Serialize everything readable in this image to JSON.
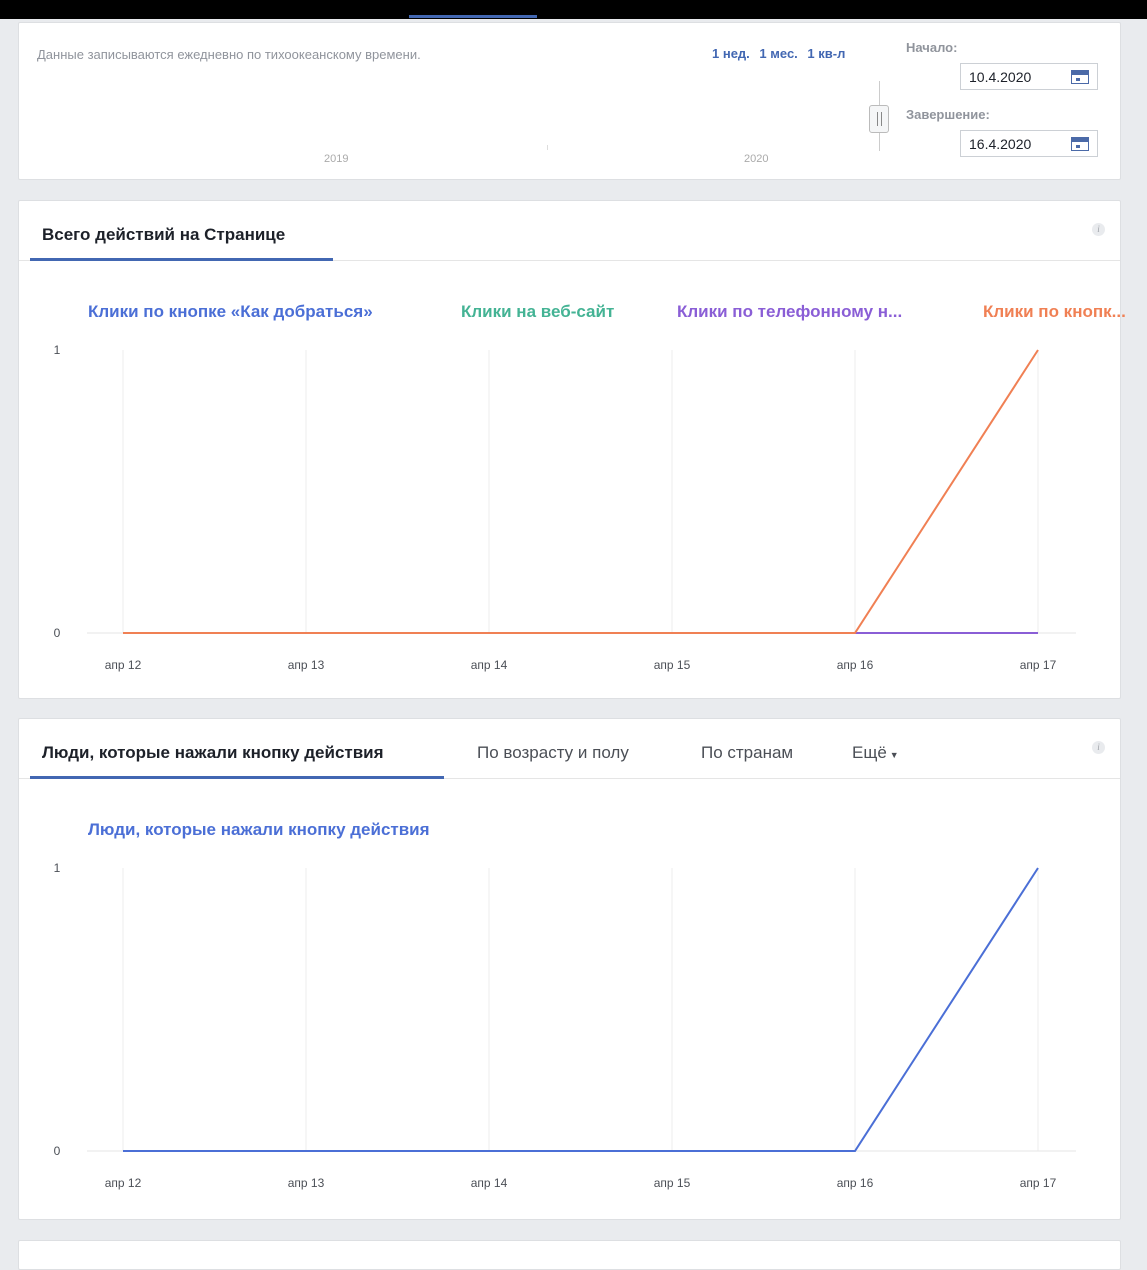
{
  "range": {
    "note": "Данные записываются ежедневно по тихоокеанскому времени.",
    "presets": [
      "1 нед.",
      "1 мес.",
      "1 кв-л"
    ],
    "start_label": "Начало:",
    "start_value": "10.4.2020",
    "end_label": "Завершение:",
    "end_value": "16.4.2020",
    "years": [
      "2019",
      "2020"
    ]
  },
  "actions": {
    "title": "Всего действий на Странице",
    "info": "i",
    "legend": [
      {
        "name": "Клики по кнопке «Как добраться»",
        "color": "#4b6fd6"
      },
      {
        "name": "Клики на веб-сайт",
        "color": "#44b394"
      },
      {
        "name": "Клики по телефонному н...",
        "color": "#8a5ed6"
      },
      {
        "name": "Клики по кнопк...",
        "color": "#f08054"
      }
    ]
  },
  "people": {
    "tabs": [
      "Люди, которые нажали кнопку действия",
      "По возрасту и полу",
      "По странам",
      "Ещё"
    ],
    "info": "i",
    "legend": [
      {
        "name": "Люди, которые нажали кнопку действия",
        "color": "#4b6fd6"
      }
    ]
  },
  "chart_data": [
    {
      "type": "line",
      "title": "Всего действий на Странице",
      "x": [
        "апр 12",
        "апр 13",
        "апр 14",
        "апр 15",
        "апр 16",
        "апр 17"
      ],
      "ylim": [
        0,
        1
      ],
      "yticks": [
        "0",
        "1"
      ],
      "grid": true,
      "series": [
        {
          "name": "Клики по кнопке «Как добраться»",
          "color": "#4b6fd6",
          "values": [
            0,
            0,
            0,
            0,
            0,
            0
          ]
        },
        {
          "name": "Клики на веб-сайт",
          "color": "#44b394",
          "values": [
            0,
            0,
            0,
            0,
            0,
            0
          ]
        },
        {
          "name": "Клики по телефонному н...",
          "color": "#8a5ed6",
          "values": [
            0,
            0,
            0,
            0,
            0,
            0
          ]
        },
        {
          "name": "Клики по кнопк...",
          "color": "#f08054",
          "values": [
            0,
            0,
            0,
            0,
            0,
            1
          ]
        }
      ]
    },
    {
      "type": "line",
      "x": [
        "апр 12",
        "апр 13",
        "апр 14",
        "апр 15",
        "апр 16",
        "апр 17"
      ],
      "ylim": [
        0,
        1
      ],
      "yticks": [
        "0",
        "1"
      ],
      "grid": true,
      "series": [
        {
          "name": "Люди, которые нажали кнопку действия",
          "color": "#4b6fd6",
          "values": [
            0,
            0,
            0,
            0,
            0,
            1
          ]
        }
      ]
    }
  ]
}
